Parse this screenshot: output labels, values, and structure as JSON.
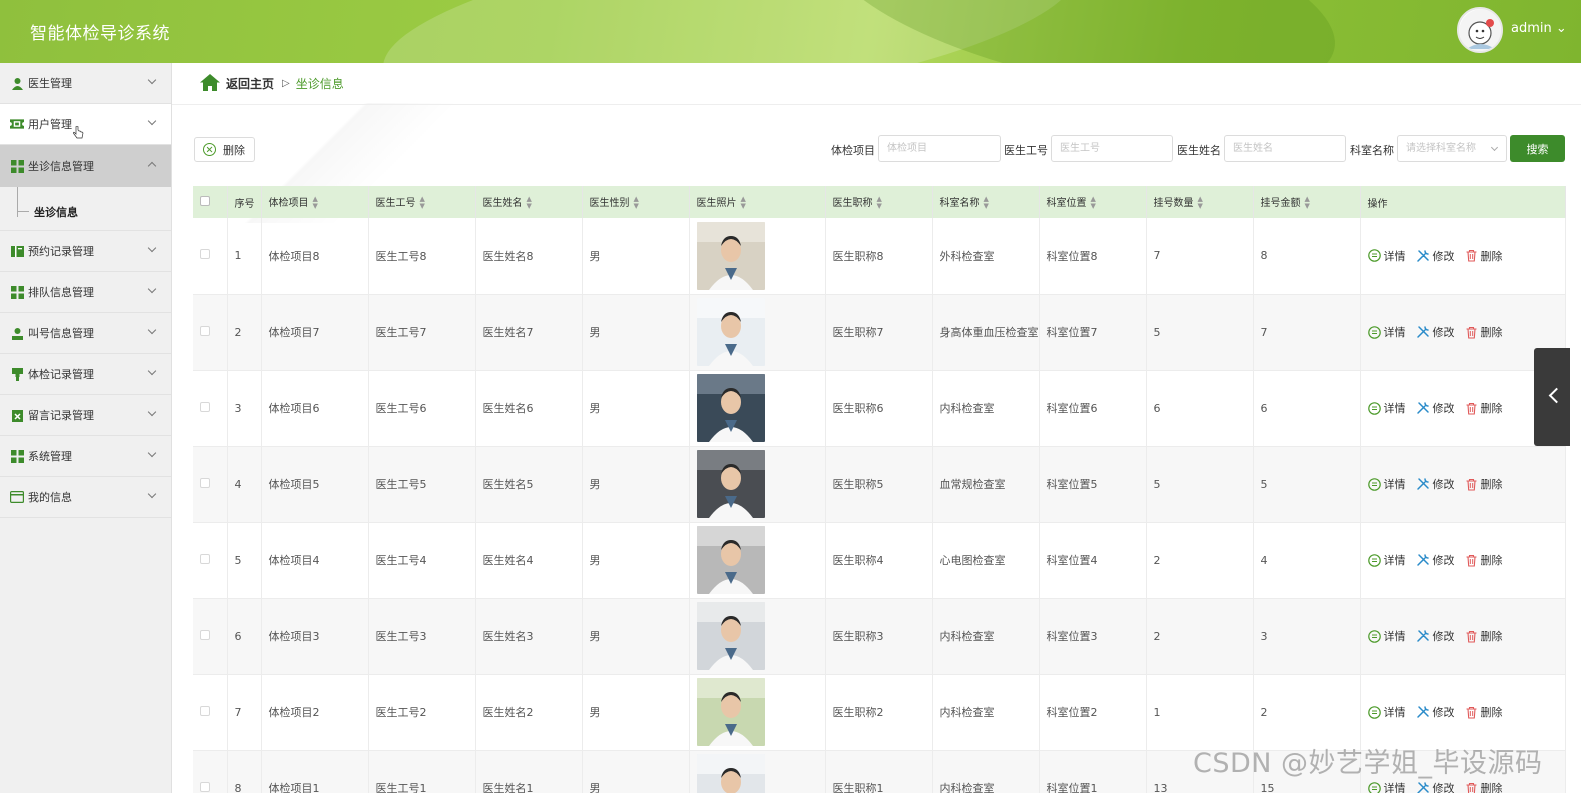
{
  "header": {
    "title": "智能体检导诊系统",
    "user": "admin ⌄"
  },
  "sidebar": {
    "items": [
      {
        "label": "医生管理",
        "icon": "user-icon"
      },
      {
        "label": "用户管理",
        "icon": "ticket-icon"
      },
      {
        "label": "坐诊信息管理",
        "icon": "grid-icon"
      },
      {
        "label": "预约记录管理",
        "icon": "book-icon"
      },
      {
        "label": "排队信息管理",
        "icon": "grid-icon"
      },
      {
        "label": "叫号信息管理",
        "icon": "user-icon"
      },
      {
        "label": "体检记录管理",
        "icon": "stamp-icon"
      },
      {
        "label": "留言记录管理",
        "icon": "clipboard-icon"
      },
      {
        "label": "系统管理",
        "icon": "grid-icon"
      },
      {
        "label": "我的信息",
        "icon": "card-icon"
      }
    ],
    "submenu": {
      "label": "坐诊信息"
    }
  },
  "breadcrumb": {
    "home": "返回主页",
    "current": "坐诊信息"
  },
  "toolbar": {
    "delete_label": "删除"
  },
  "search": {
    "fields": [
      {
        "label": "体检项目",
        "placeholder": "体检项目"
      },
      {
        "label": "医生工号",
        "placeholder": "医生工号"
      },
      {
        "label": "医生姓名",
        "placeholder": "医生姓名"
      },
      {
        "label": "科室名称",
        "placeholder": "请选择科室名称"
      }
    ],
    "button": "搜索"
  },
  "table": {
    "columns": [
      "序号",
      "体检项目",
      "医生工号",
      "医生姓名",
      "医生性别",
      "医生照片",
      "医生职称",
      "科室名称",
      "科室位置",
      "挂号数量",
      "挂号金额",
      "操作"
    ],
    "actions": {
      "detail": "详情",
      "edit": "修改",
      "delete": "删除"
    },
    "rows": [
      {
        "no": "1",
        "item": "体检项目8",
        "job": "医生工号8",
        "name": "医生姓名8",
        "gender": "男",
        "title": "医生职称8",
        "dept": "外科检查室",
        "loc": "科室位置8",
        "count": "7",
        "fee": "8"
      },
      {
        "no": "2",
        "item": "体检项目7",
        "job": "医生工号7",
        "name": "医生姓名7",
        "gender": "男",
        "title": "医生职称7",
        "dept": "身高体重血压检查室",
        "loc": "科室位置7",
        "count": "5",
        "fee": "7"
      },
      {
        "no": "3",
        "item": "体检项目6",
        "job": "医生工号6",
        "name": "医生姓名6",
        "gender": "男",
        "title": "医生职称6",
        "dept": "内科检查室",
        "loc": "科室位置6",
        "count": "6",
        "fee": "6"
      },
      {
        "no": "4",
        "item": "体检项目5",
        "job": "医生工号5",
        "name": "医生姓名5",
        "gender": "男",
        "title": "医生职称5",
        "dept": "血常规检查室",
        "loc": "科室位置5",
        "count": "5",
        "fee": "5"
      },
      {
        "no": "5",
        "item": "体检项目4",
        "job": "医生工号4",
        "name": "医生姓名4",
        "gender": "男",
        "title": "医生职称4",
        "dept": "心电图检查室",
        "loc": "科室位置4",
        "count": "2",
        "fee": "4"
      },
      {
        "no": "6",
        "item": "体检项目3",
        "job": "医生工号3",
        "name": "医生姓名3",
        "gender": "男",
        "title": "医生职称3",
        "dept": "内科检查室",
        "loc": "科室位置3",
        "count": "2",
        "fee": "3"
      },
      {
        "no": "7",
        "item": "体检项目2",
        "job": "医生工号2",
        "name": "医生姓名2",
        "gender": "男",
        "title": "医生职称2",
        "dept": "内科检查室",
        "loc": "科室位置2",
        "count": "1",
        "fee": "2"
      },
      {
        "no": "8",
        "item": "体检项目1",
        "job": "医生工号1",
        "name": "医生姓名1",
        "gender": "男",
        "title": "医生职称1",
        "dept": "内科检查室",
        "loc": "科室位置1",
        "count": "13",
        "fee": "15"
      }
    ]
  },
  "watermark": "CSDN @妙艺学姐_毕设源码",
  "colors": {
    "brand": "#8cbf36",
    "accent": "#3d8b2b",
    "link": "#4c9a2a"
  }
}
